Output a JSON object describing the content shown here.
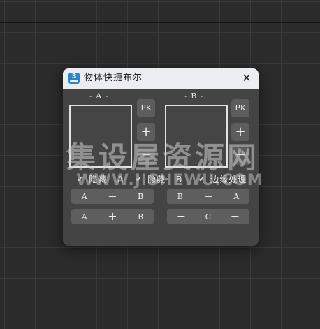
{
  "window": {
    "title": "物体快捷布尔",
    "app_icon_label": "3",
    "close_glyph": "✕"
  },
  "group_a": {
    "label": "- A -",
    "pk_label": "PK",
    "plus_label": "+",
    "minus_label": "−",
    "hide_label": "隐藏 - A",
    "hide_checked": true
  },
  "group_b": {
    "label": "- B -",
    "pk_label": "PK",
    "plus_label": "+",
    "minus_label": "−",
    "hide_label": "隐藏 - B",
    "hide_checked": true
  },
  "edge_option": {
    "label": "边缘处理",
    "checked": true
  },
  "check_glyph": "✔",
  "operations": {
    "a_minus_b": {
      "left": "A",
      "sym": "−",
      "right": "B"
    },
    "b_minus_a": {
      "left": "B",
      "sym": "−",
      "right": "A"
    },
    "a_plus_b": {
      "left": "A",
      "sym": "+",
      "right": "B"
    },
    "c_combo": {
      "left": "−",
      "mid": "C",
      "right": "−"
    }
  },
  "watermark": {
    "chinese": "集设屋资源网",
    "url": "WWW.JISHEWU.COM"
  }
}
